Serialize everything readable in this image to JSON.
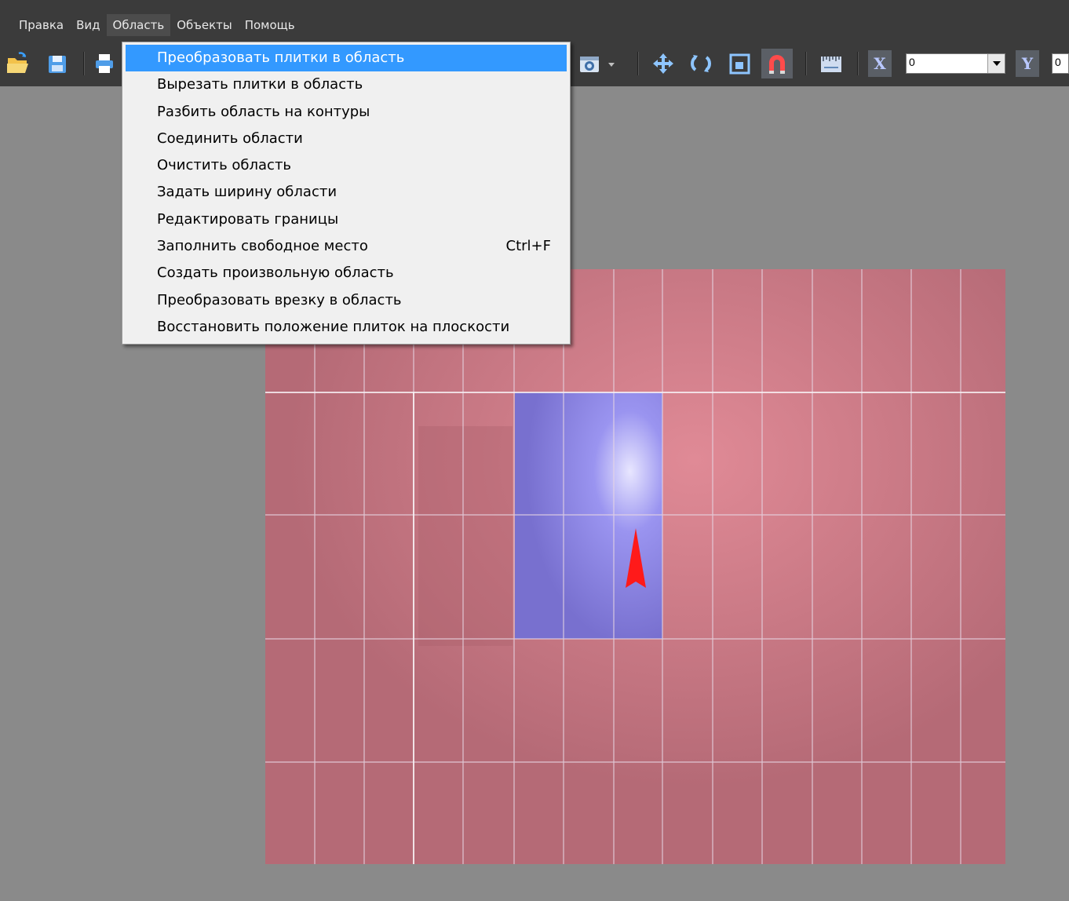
{
  "menu_bar": {
    "items": [
      {
        "label": "Правка"
      },
      {
        "label": "Вид"
      },
      {
        "label": "Область"
      },
      {
        "label": "Объекты"
      },
      {
        "label": "Помощь"
      }
    ]
  },
  "toolbar": {
    "x_label": "X",
    "x_value": "0",
    "y_label": "Y",
    "y_value": "0",
    "icons": [
      "open-icon",
      "save-icon",
      "print-icon",
      "camera-icon",
      "camera-dropdown-icon",
      "move-icon",
      "rotate-icon",
      "scale-icon",
      "magnet-icon",
      "ruler-icon"
    ]
  },
  "dropdown_menu": {
    "items": [
      {
        "label": "Преобразовать плитки в область",
        "shortcut": "",
        "selected": true
      },
      {
        "label": "Вырезать плитки в область",
        "shortcut": ""
      },
      {
        "label": "Разбить область на контуры",
        "shortcut": ""
      },
      {
        "label": "Соединить области",
        "shortcut": ""
      },
      {
        "label": "Очистить область",
        "shortcut": ""
      },
      {
        "label": "Задать ширину области",
        "shortcut": ""
      },
      {
        "label": "Редактировать границы",
        "shortcut": ""
      },
      {
        "label": "Заполнить свободное место",
        "shortcut": "Ctrl+F"
      },
      {
        "label": "Создать произвольную область",
        "shortcut": ""
      },
      {
        "label": "Преобразовать врезку в область",
        "shortcut": ""
      },
      {
        "label": "Восстановить положение плиток на плоскости",
        "shortcut": ""
      }
    ]
  },
  "colors": {
    "tile_area": "#b96f7a",
    "selected_tiles": "#7a74d8",
    "grid_line": "#e9d6e6",
    "arrow": "#ff1a1a",
    "menu_highlight": "#3399ff"
  }
}
